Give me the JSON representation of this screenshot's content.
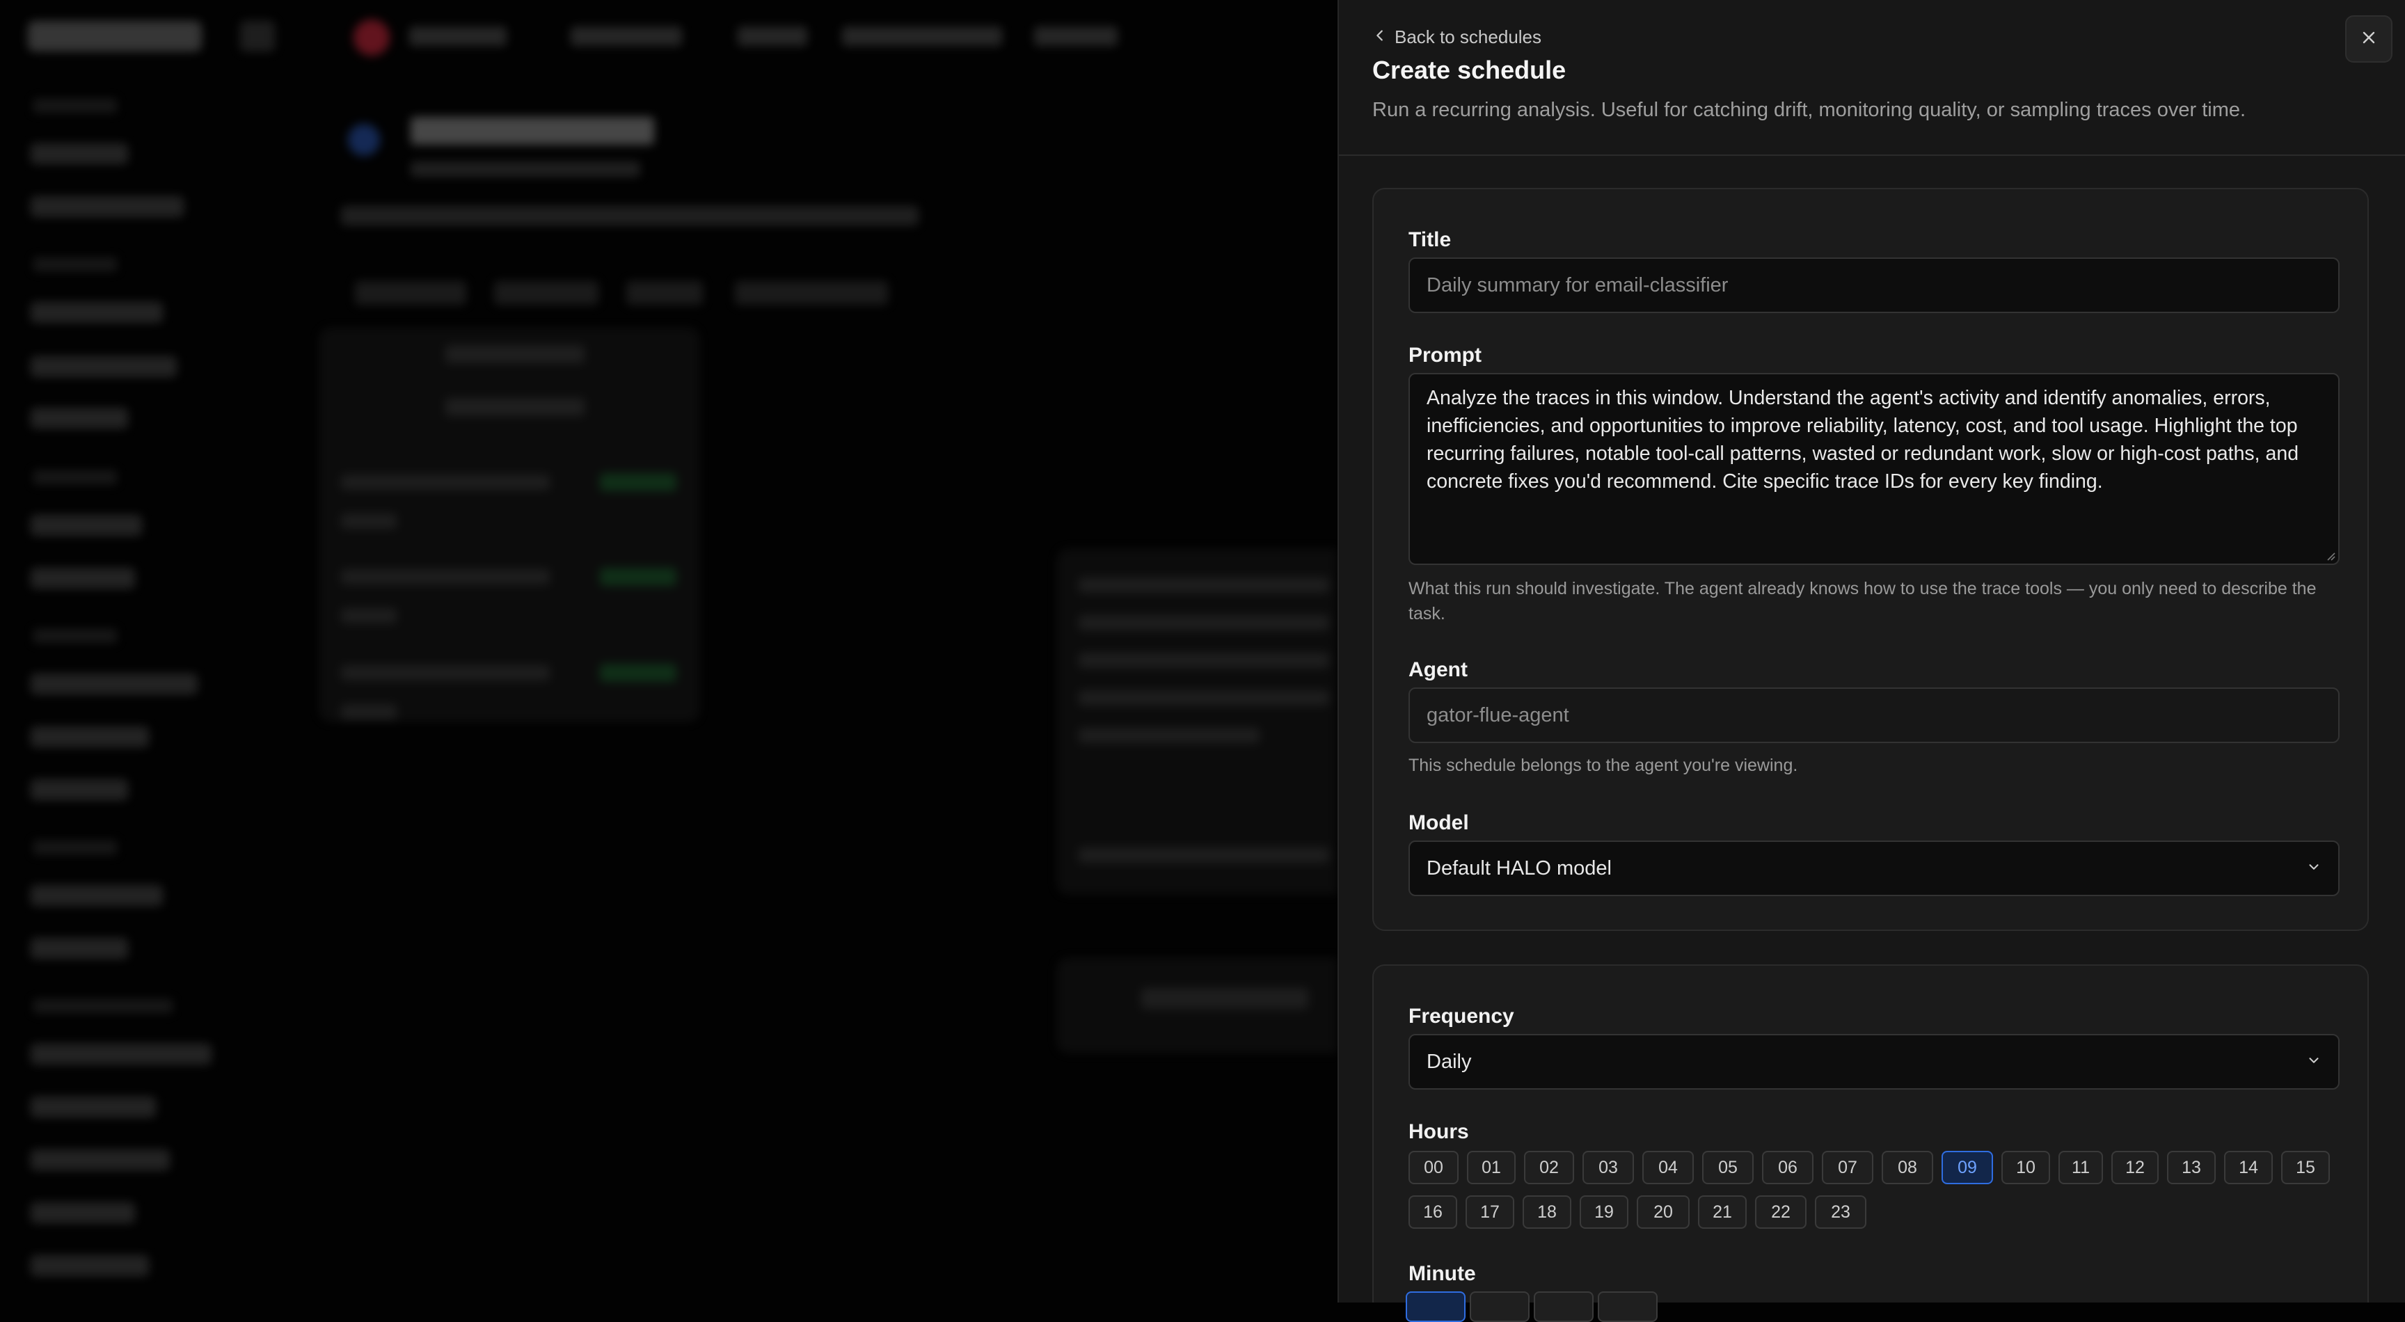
{
  "panel": {
    "back_label": "Back to schedules",
    "title": "Create schedule",
    "description": "Run a recurring analysis. Useful for catching drift, monitoring quality, or sampling traces over time."
  },
  "form": {
    "title_label": "Title",
    "title_placeholder": "Daily summary for email-classifier",
    "prompt_label": "Prompt",
    "prompt_value": "Analyze the traces in this window. Understand the agent's activity and identify anomalies, errors, inefficiencies, and opportunities to improve reliability, latency, cost, and tool usage. Highlight the top recurring failures, notable tool-call patterns, wasted or redundant work, slow or high-cost paths, and concrete fixes you'd recommend. Cite specific trace IDs for every key finding.",
    "prompt_help": "What this run should investigate. The agent already knows how to use the trace tools — you only need to describe the task.",
    "agent_label": "Agent",
    "agent_value": "gator-flue-agent",
    "agent_help": "This schedule belongs to the agent you're viewing.",
    "model_label": "Model",
    "model_value": "Default HALO model",
    "frequency_label": "Frequency",
    "frequency_value": "Daily",
    "hours_label": "Hours",
    "hours": [
      "00",
      "01",
      "02",
      "03",
      "04",
      "05",
      "06",
      "07",
      "08",
      "09",
      "10",
      "11",
      "12",
      "13",
      "14",
      "15",
      "16",
      "17",
      "18",
      "19",
      "20",
      "21",
      "22",
      "23"
    ],
    "selected_hour": "09",
    "minute_label": "Minute"
  },
  "icons": {
    "back": "chevron-left-icon",
    "close": "close-icon",
    "select": "chevron-down-icon"
  },
  "colors": {
    "accent": "#2f6de0",
    "panel_bg": "#171717",
    "card_bg": "#1b1b1b"
  }
}
